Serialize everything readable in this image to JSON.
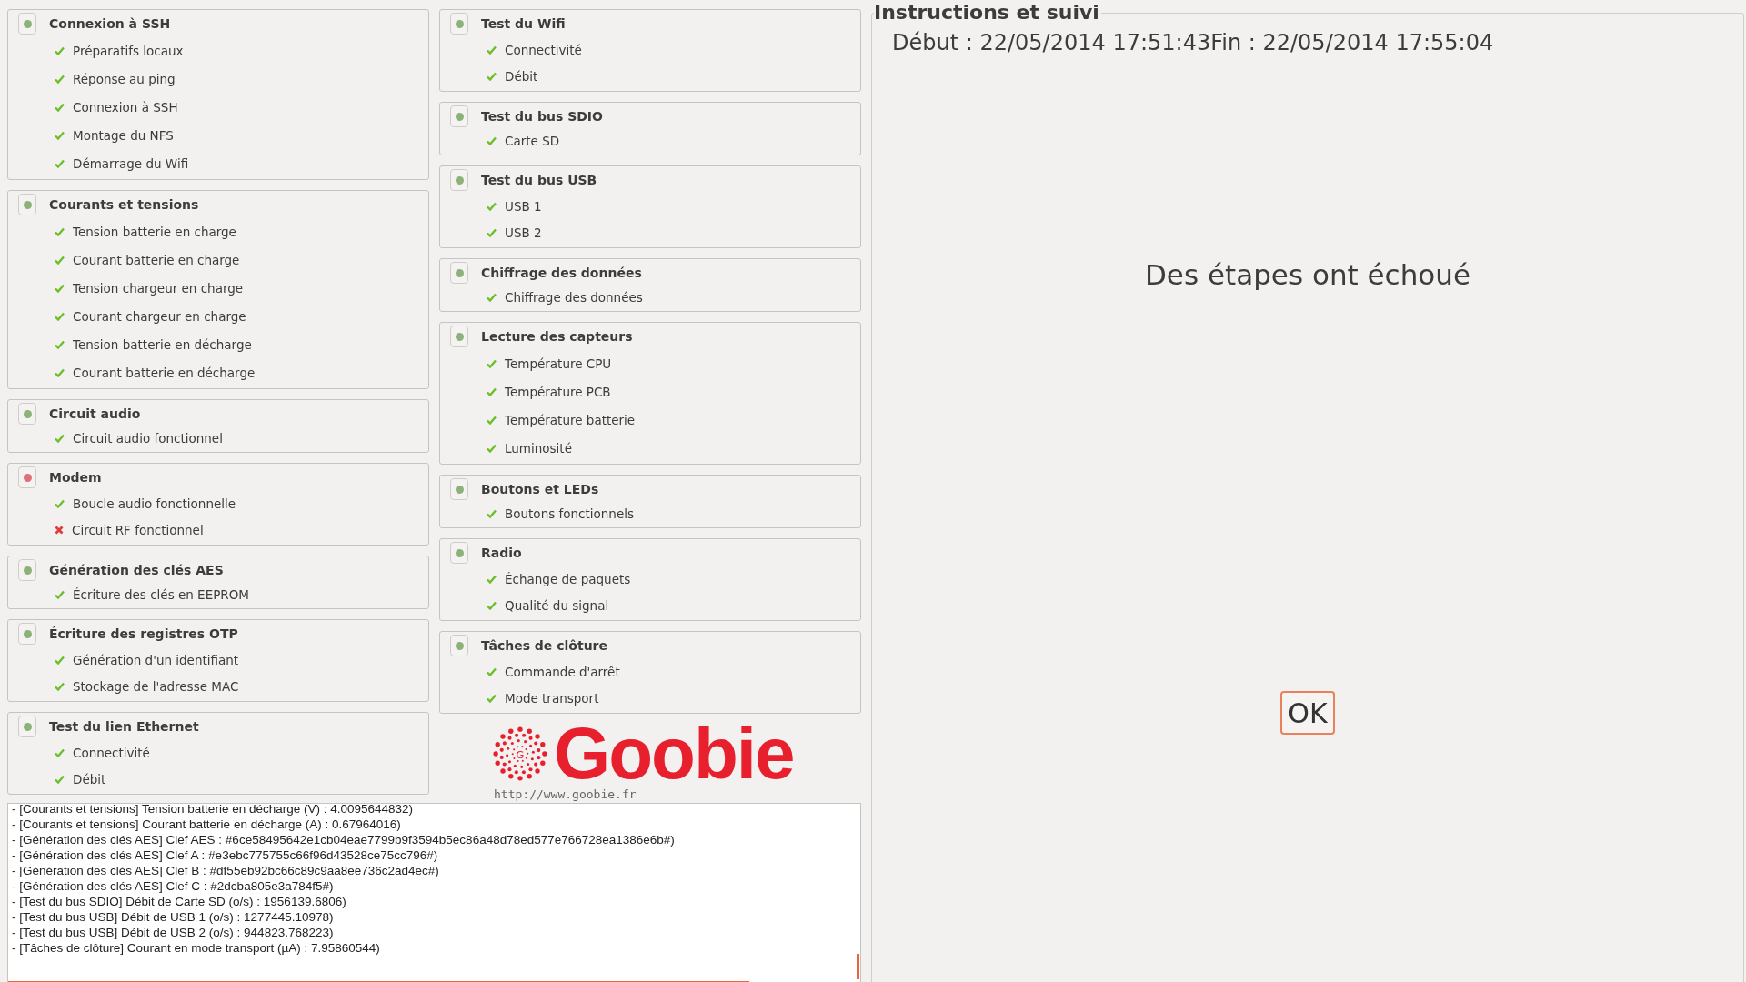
{
  "columns": [
    {
      "groups": [
        {
          "title": "Connexion à SSH",
          "passed": true,
          "items": [
            {
              "label": "Préparatifs locaux",
              "passed": true
            },
            {
              "label": "Réponse au ping",
              "passed": true
            },
            {
              "label": "Connexion à SSH",
              "passed": true
            },
            {
              "label": "Montage du NFS",
              "passed": true
            },
            {
              "label": "Démarrage du Wifi",
              "passed": true
            }
          ]
        },
        {
          "title": "Courants et tensions",
          "passed": true,
          "items": [
            {
              "label": "Tension batterie en charge",
              "passed": true
            },
            {
              "label": "Courant batterie en charge",
              "passed": true
            },
            {
              "label": "Tension chargeur en charge",
              "passed": true
            },
            {
              "label": "Courant chargeur en charge",
              "passed": true
            },
            {
              "label": "Tension batterie en décharge",
              "passed": true
            },
            {
              "label": "Courant batterie en décharge",
              "passed": true
            }
          ]
        },
        {
          "title": "Circuit audio",
          "passed": true,
          "items": [
            {
              "label": "Circuit audio fonctionnel",
              "passed": true
            }
          ]
        },
        {
          "title": "Modem",
          "passed": false,
          "items": [
            {
              "label": "Boucle audio fonctionnelle",
              "passed": true
            },
            {
              "label": "Circuit RF fonctionnel",
              "passed": false
            }
          ]
        },
        {
          "title": "Génération des clés AES",
          "passed": true,
          "items": [
            {
              "label": "Écriture des clés en EEPROM",
              "passed": true
            }
          ]
        },
        {
          "title": "Écriture des registres OTP",
          "passed": true,
          "items": [
            {
              "label": "Génération d'un identifiant",
              "passed": true
            },
            {
              "label": "Stockage de l'adresse MAC",
              "passed": true
            }
          ]
        },
        {
          "title": "Test du lien Ethernet",
          "passed": true,
          "items": [
            {
              "label": "Connectivité",
              "passed": true
            },
            {
              "label": "Débit",
              "passed": true
            }
          ]
        }
      ]
    },
    {
      "groups": [
        {
          "title": "Test du Wifi",
          "passed": true,
          "items": [
            {
              "label": "Connectivité",
              "passed": true
            },
            {
              "label": "Débit",
              "passed": true
            }
          ]
        },
        {
          "title": "Test du bus SDIO",
          "passed": true,
          "items": [
            {
              "label": "Carte SD",
              "passed": true
            }
          ]
        },
        {
          "title": "Test du bus USB",
          "passed": true,
          "items": [
            {
              "label": "USB 1",
              "passed": true
            },
            {
              "label": "USB 2",
              "passed": true
            }
          ]
        },
        {
          "title": "Chiffrage des données",
          "passed": true,
          "items": [
            {
              "label": "Chiffrage des données",
              "passed": true
            }
          ]
        },
        {
          "title": "Lecture des capteurs",
          "passed": true,
          "items": [
            {
              "label": "Température CPU",
              "passed": true
            },
            {
              "label": "Température PCB",
              "passed": true
            },
            {
              "label": "Température batterie",
              "passed": true
            },
            {
              "label": "Luminosité",
              "passed": true
            }
          ]
        },
        {
          "title": "Boutons et LEDs",
          "passed": true,
          "items": [
            {
              "label": "Boutons fonctionnels",
              "passed": true
            }
          ]
        },
        {
          "title": "Radio",
          "passed": true,
          "items": [
            {
              "label": "Échange de paquets",
              "passed": true
            },
            {
              "label": "Qualité du signal",
              "passed": true
            }
          ]
        },
        {
          "title": "Tâches de clôture",
          "passed": true,
          "items": [
            {
              "label": "Commande d'arrêt",
              "passed": true
            },
            {
              "label": "Mode transport",
              "passed": true
            }
          ]
        }
      ]
    }
  ],
  "logo": {
    "mark": "G",
    "name": "Goobie",
    "url": "http://www.goobie.fr"
  },
  "log": [
    "- [Courants et tensions] Tension batterie en décharge (V) : 4.0095644832)",
    "- [Courants et tensions] Courant batterie en décharge (A) : 0.67964016)",
    "- [Génération des clés AES] Clef AES : #6ce58495642e1cb04eae7799b9f3594b5ec86a48d78ed577e766728ea1386e6b#)",
    "- [Génération des clés AES] Clef A : #e3ebc775755c66f96d43528ce75cc796#)",
    "- [Génération des clés AES] Clef B : #df55eb92bc66c89c9aa8ee736c2ad4ec#)",
    "- [Génération des clés AES] Clef C : #2dcba805e3a784f5#)",
    "- [Test du bus SDIO] Débit de Carte SD (o/s) : 1956139.6806)",
    "- [Test du bus USB] Débit de USB 1 (o/s) : 1277445.10978)",
    "- [Test du bus USB] Débit de USB 2 (o/s) : 944823.768223)",
    "- [Tâches de clôture] Courant en mode transport (µA) : 7.95860544)"
  ],
  "panel": {
    "title": "Instructions et suivi",
    "times": "Début : 22/05/2014 17:51:43Fin : 22/05/2014 17:55:04",
    "message": "Des étapes ont échoué",
    "button": "OK"
  }
}
